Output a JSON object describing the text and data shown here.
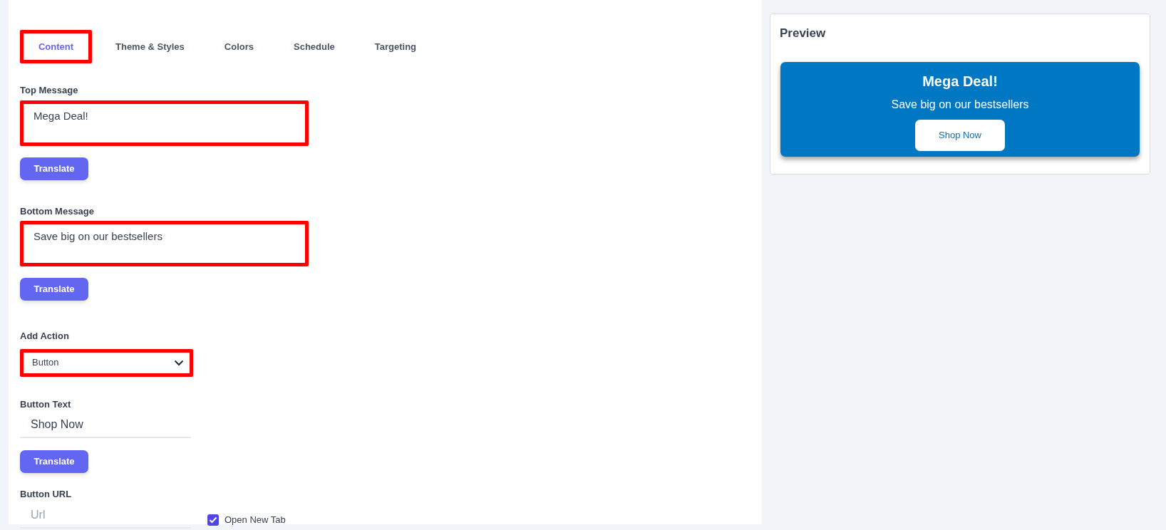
{
  "tabs": [
    {
      "label": "Content",
      "selected": true,
      "highlighted": true
    },
    {
      "label": "Theme & Styles",
      "selected": false,
      "highlighted": false
    },
    {
      "label": "Colors",
      "selected": false,
      "highlighted": false
    },
    {
      "label": "Schedule",
      "selected": false,
      "highlighted": false
    },
    {
      "label": "Targeting",
      "selected": false,
      "highlighted": false
    }
  ],
  "top_message": {
    "label": "Top Message",
    "value": "Mega Deal!",
    "highlighted": true,
    "button": "Translate"
  },
  "bottom_message": {
    "label": "Bottom Message",
    "value": "Save big on our bestsellers",
    "highlighted": true,
    "button": "Translate"
  },
  "add_action": {
    "label": "Add Action",
    "value": "Button",
    "highlighted": true
  },
  "button_text": {
    "label": "Button Text",
    "value": "Shop Now",
    "button": "Translate"
  },
  "button_url": {
    "label": "Button URL",
    "placeholder": "Url"
  },
  "open_new_tab": {
    "label": "Open New Tab",
    "checked": true
  },
  "preview": {
    "title": "Preview",
    "banner": {
      "title": "Mega Deal!",
      "subtitle": "Save big on our bestsellers",
      "button": "Shop Now"
    }
  }
}
